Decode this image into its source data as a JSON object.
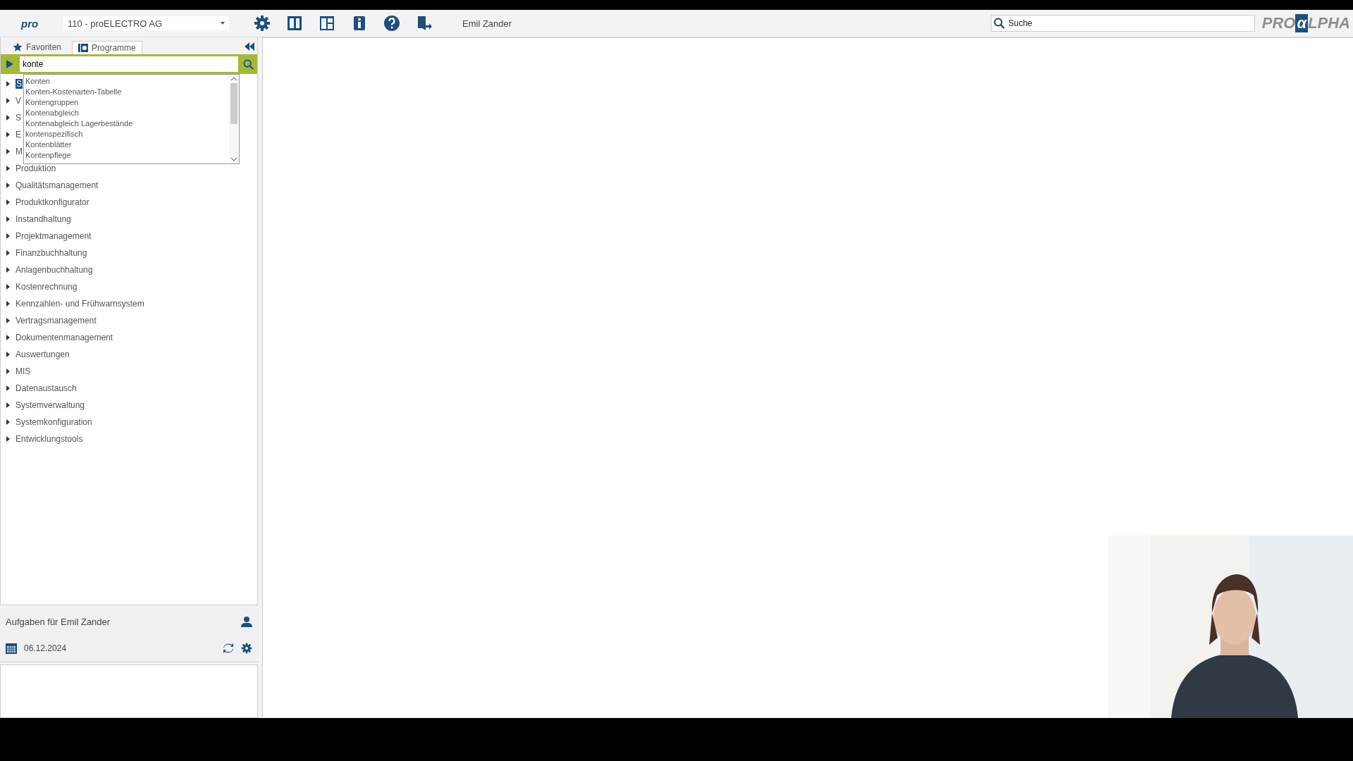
{
  "top_bar": {
    "logo": "pro",
    "company_select": "110 - proELECTRO AG",
    "user": "Emil Zander",
    "search": {
      "placeholder": "Suche"
    },
    "brand_logo": [
      "PRO",
      "α",
      "LPHA"
    ]
  },
  "sidebar": {
    "tabs": [
      {
        "label": "Favoriten",
        "selected": false
      },
      {
        "label": "Programme",
        "selected": true
      }
    ],
    "search": {
      "value": "konte"
    },
    "suggestions": [
      "Konten",
      "Konten-Kostenarten-Tabelle",
      "Kontengruppen",
      "Kontenabgleich",
      "Kontenabgleich Lagerbestände",
      "kontenspezifisch",
      "Kontenblätter",
      "Kontenpflege"
    ],
    "tree": [
      {
        "label": "S",
        "selected": true
      },
      {
        "label": "V",
        "selected": false
      },
      {
        "label": "S",
        "selected": false
      },
      {
        "label": "E",
        "selected": false
      },
      {
        "label": "M",
        "selected": false
      },
      {
        "label": "Produktion",
        "selected": false
      },
      {
        "label": "Qualitätsmanagement",
        "selected": false
      },
      {
        "label": "Produktkonfigurator",
        "selected": false
      },
      {
        "label": "Instandhaltung",
        "selected": false
      },
      {
        "label": "Projektmanagement",
        "selected": false
      },
      {
        "label": "Finanzbuchhaltung",
        "selected": false
      },
      {
        "label": "Anlagenbuchhaltung",
        "selected": false
      },
      {
        "label": "Kostenrechnung",
        "selected": false
      },
      {
        "label": "Kennzahlen- und Frühwarnsystem",
        "selected": false
      },
      {
        "label": "Vertragsmanagement",
        "selected": false
      },
      {
        "label": "Dokumentenmanagement",
        "selected": false
      },
      {
        "label": "Auswertungen",
        "selected": false
      },
      {
        "label": "MIS",
        "selected": false
      },
      {
        "label": "Datenaustausch",
        "selected": false
      },
      {
        "label": "Systemverwaltung",
        "selected": false
      },
      {
        "label": "Systemkonfiguration",
        "selected": false
      },
      {
        "label": "Entwicklungstools",
        "selected": false
      }
    ]
  },
  "tasks": {
    "title": "Aufgaben für Emil Zander",
    "date": "06.12.2024"
  }
}
